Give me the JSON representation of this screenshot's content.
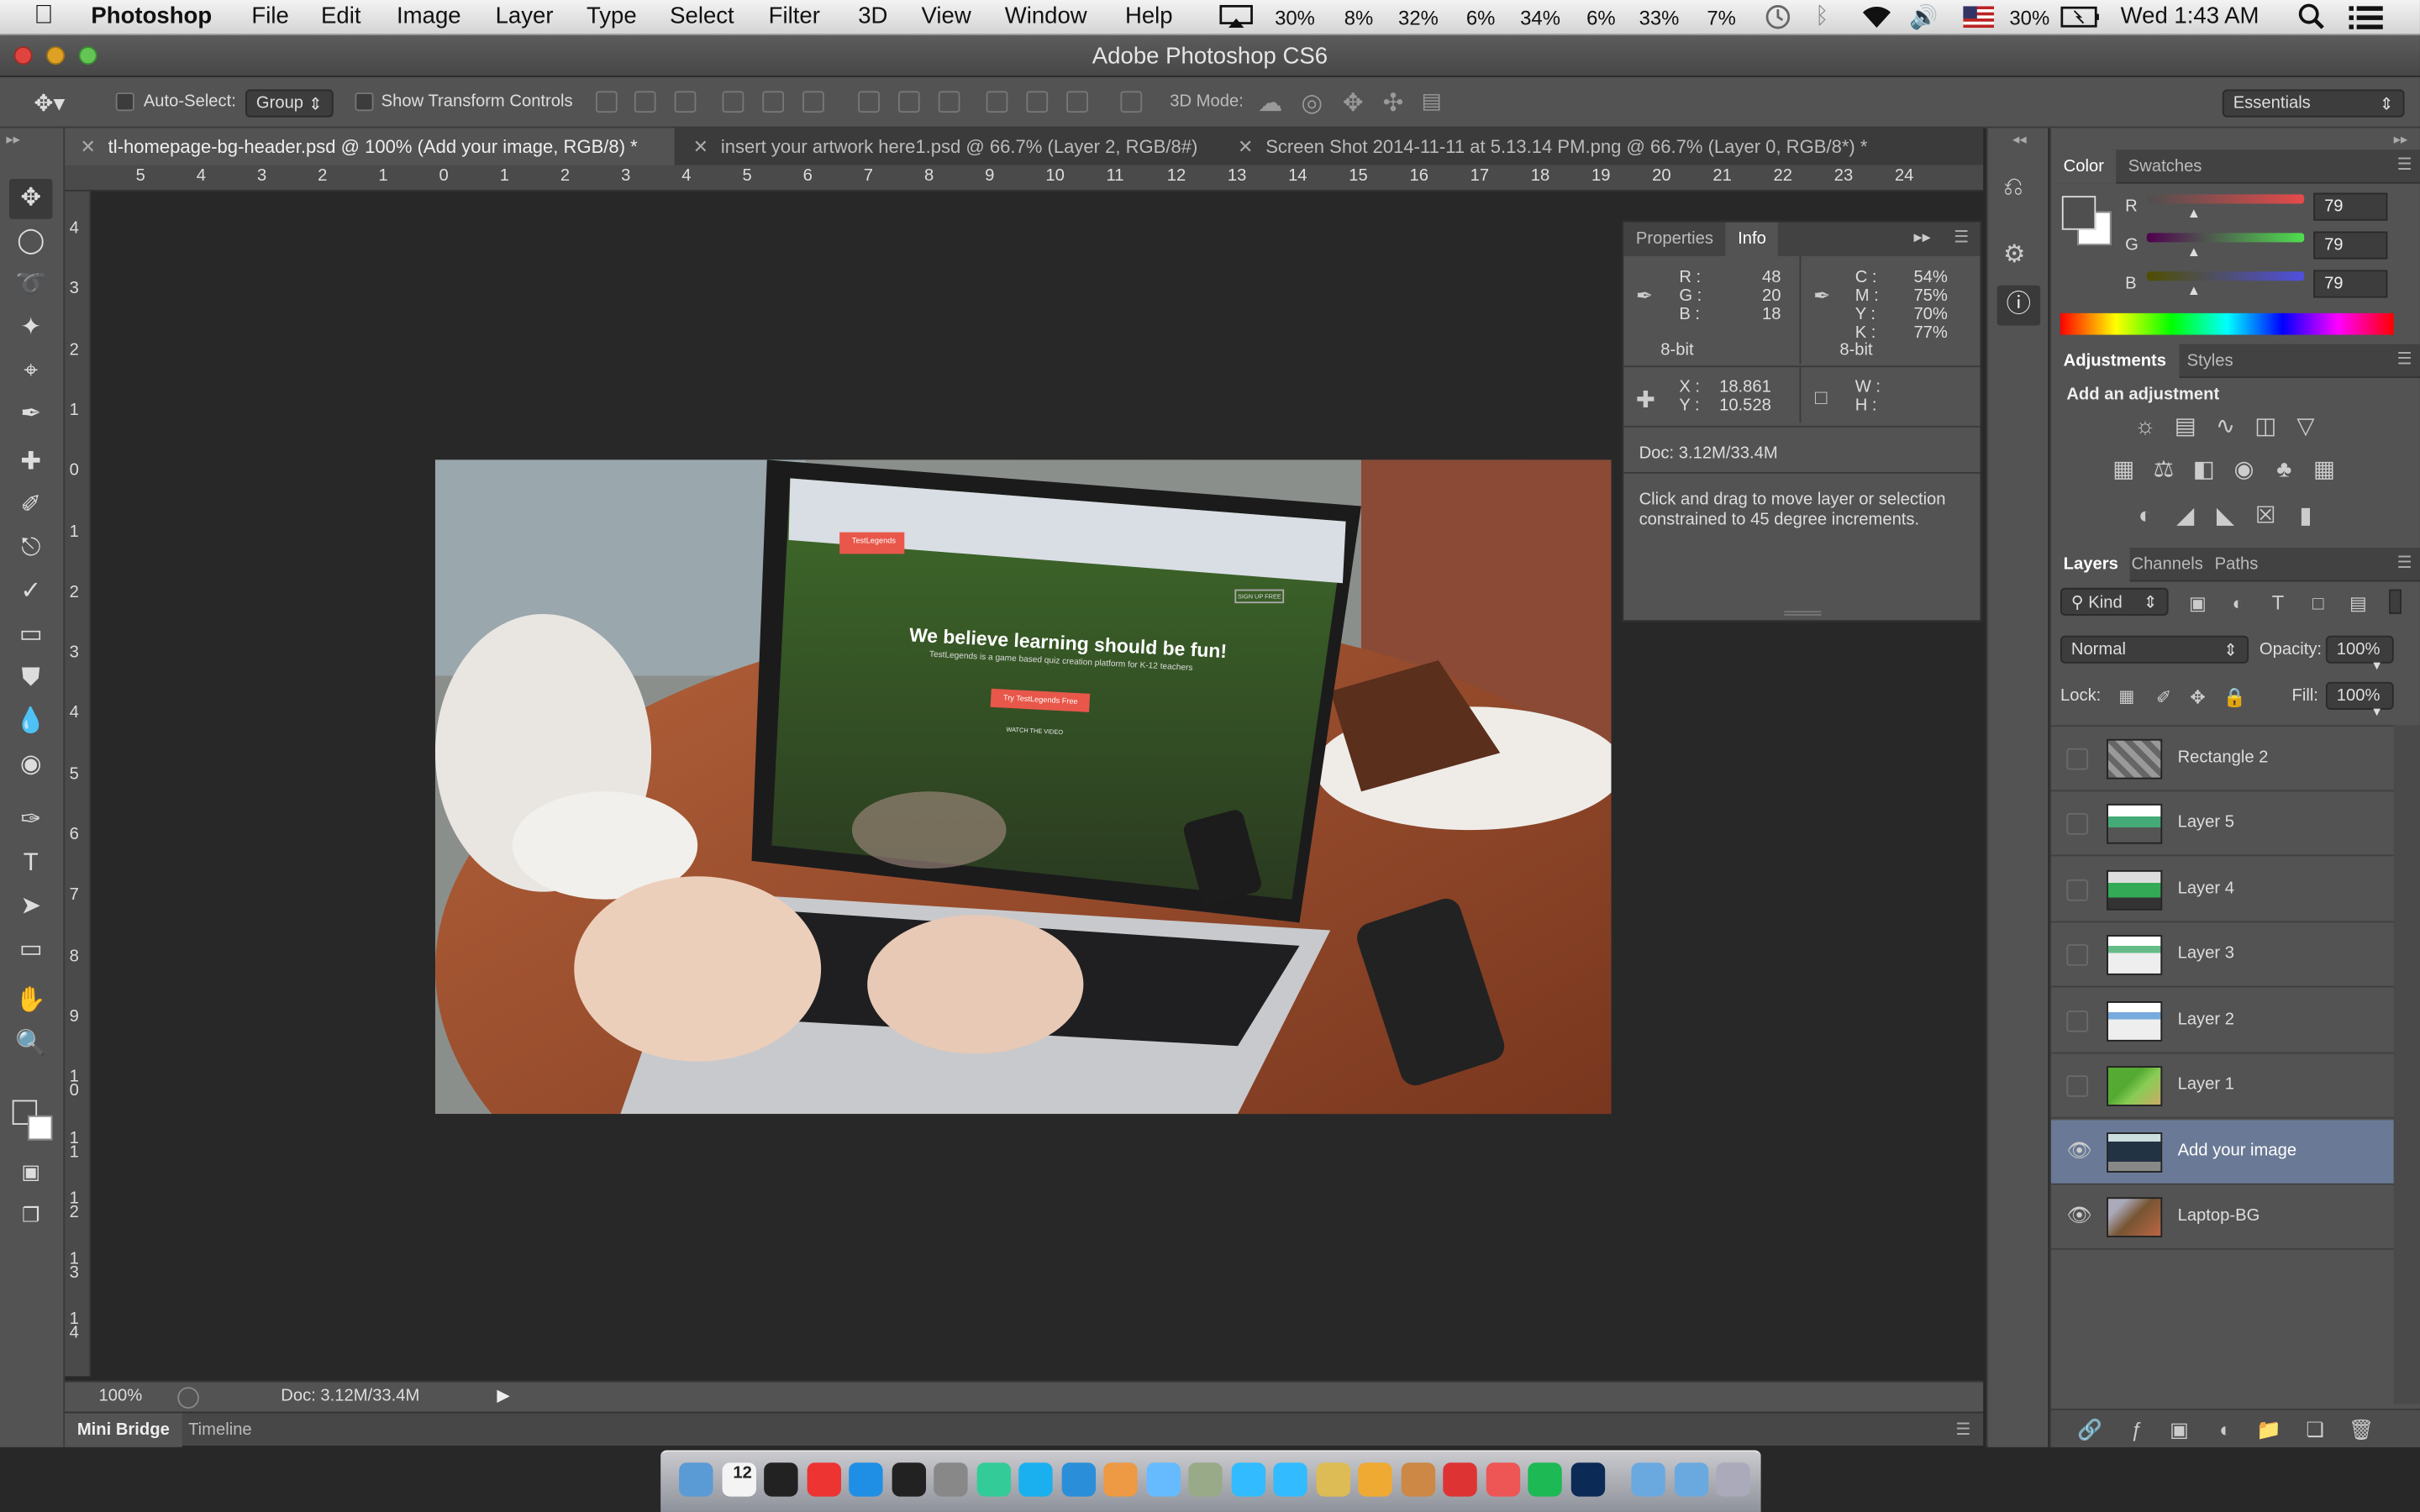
{
  "menubar": {
    "apple": "",
    "app": "Photoshop",
    "items": [
      "File",
      "Edit",
      "Image",
      "Layer",
      "Type",
      "Select",
      "Filter",
      "3D",
      "View",
      "Window",
      "Help"
    ],
    "status": [
      "30%",
      "8%",
      "32%",
      "6%",
      "34%",
      "6%",
      "33%",
      "7%"
    ],
    "battery": "30%",
    "clock": "Wed 1:43 AM"
  },
  "window": {
    "title": "Adobe Photoshop CS6"
  },
  "options": {
    "auto_select": "Auto-Select:",
    "group": "Group",
    "show_transform": "Show Transform Controls",
    "mode_3d": "3D Mode:",
    "workspace": "Essentials"
  },
  "tabs": [
    {
      "label": "tl-homepage-bg-header.psd @ 100% (Add your image, RGB/8) *",
      "active": true
    },
    {
      "label": "insert your artwork here1.psd @ 66.7% (Layer 2, RGB/8#)"
    },
    {
      "label": "Screen Shot 2014-11-11 at 5.13.14 PM.png @ 66.7% (Layer 0, RGB/8*) *"
    }
  ],
  "ruler_h": [
    "5",
    "4",
    "3",
    "2",
    "1",
    "0",
    "1",
    "2",
    "3",
    "4",
    "5",
    "6",
    "7",
    "8",
    "9",
    "10",
    "11",
    "12",
    "13",
    "14",
    "15",
    "16",
    "17",
    "18",
    "19",
    "20",
    "21",
    "22",
    "23",
    "24"
  ],
  "ruler_v": [
    "4",
    "3",
    "2",
    "1",
    "0",
    "1",
    "2",
    "3",
    "4",
    "5",
    "6",
    "7",
    "8",
    "9",
    "1 0",
    "1 1",
    "1 2",
    "1 3",
    "1 4"
  ],
  "image": {
    "headline": "We believe learning should be fun!",
    "sub": "TestLegends is a game based quiz creation platform for K-12 teachers",
    "cta": "Try TestLegends Free",
    "brand": "TestLegends",
    "signup": "SIGN UP FREE",
    "watch": "WATCH THE VIDEO"
  },
  "status": {
    "zoom": "100%",
    "doc": "Doc: 3.12M/33.4M"
  },
  "bottom_tabs": [
    "Mini Bridge",
    "Timeline"
  ],
  "info": {
    "tabs": [
      "Properties",
      "Info"
    ],
    "rgb": {
      "R": "48",
      "G": "20",
      "B": "18"
    },
    "rgb_labels": [
      "R :",
      "G :",
      "B :"
    ],
    "cmyk": {
      "C": "54%",
      "M": "75%",
      "Y": "70%",
      "K": "77%"
    },
    "cmyk_labels": [
      "C :",
      "M :",
      "Y :",
      "K :"
    ],
    "bit1": "8-bit",
    "bit2": "8-bit",
    "xy": {
      "X": "18.861",
      "Y": "10.528"
    },
    "xy_labels": [
      "X :",
      "Y :"
    ],
    "wh_labels": [
      "W :",
      "H :"
    ],
    "doc": "Doc: 3.12M/33.4M",
    "hint": "Click and drag to move layer or selection constrained to 45 degree increments."
  },
  "color": {
    "tabs": [
      "Color",
      "Swatches"
    ],
    "labels": [
      "R",
      "G",
      "B"
    ],
    "values": [
      "79",
      "79",
      "79"
    ],
    "foreground": "#4f4f4f"
  },
  "adjustments": {
    "tabs": [
      "Adjustments",
      "Styles"
    ],
    "title": "Add an adjustment"
  },
  "layers": {
    "tabs": [
      "Layers",
      "Channels",
      "Paths"
    ],
    "filter": "Kind",
    "blend": "Normal",
    "opacity_label": "Opacity:",
    "opacity": "100%",
    "lock_label": "Lock:",
    "fill_label": "Fill:",
    "fill": "100%",
    "items": [
      {
        "name": "Rectangle 2",
        "visible": false
      },
      {
        "name": "Layer 5",
        "visible": false
      },
      {
        "name": "Layer 4",
        "visible": false
      },
      {
        "name": "Layer 3",
        "visible": false
      },
      {
        "name": "Layer 2",
        "visible": false
      },
      {
        "name": "Layer 1",
        "visible": false
      },
      {
        "name": "Add your image",
        "visible": true,
        "selected": true
      },
      {
        "name": "Laptop-BG",
        "visible": true
      }
    ]
  },
  "dock": {
    "calendar_day": "12",
    "items": [
      "finder-icon",
      "calendar-icon",
      "activity-monitor-icon",
      "itunes-icon",
      "app-store-icon",
      "terminal-icon",
      "photo-booth-icon",
      "app-icon",
      "skype-icon",
      "safari-icon",
      "chrome-icon",
      "messages-icon",
      "app-icon-2",
      "twitter-icon",
      "twitter-icon-2",
      "app-icon-3",
      "app-icon-4",
      "app-icon-5",
      "mail-icon",
      "popcorn-icon",
      "spotify-icon",
      "photoshop-icon",
      "folder-icon",
      "folder-icon-2",
      "trash-icon"
    ]
  }
}
